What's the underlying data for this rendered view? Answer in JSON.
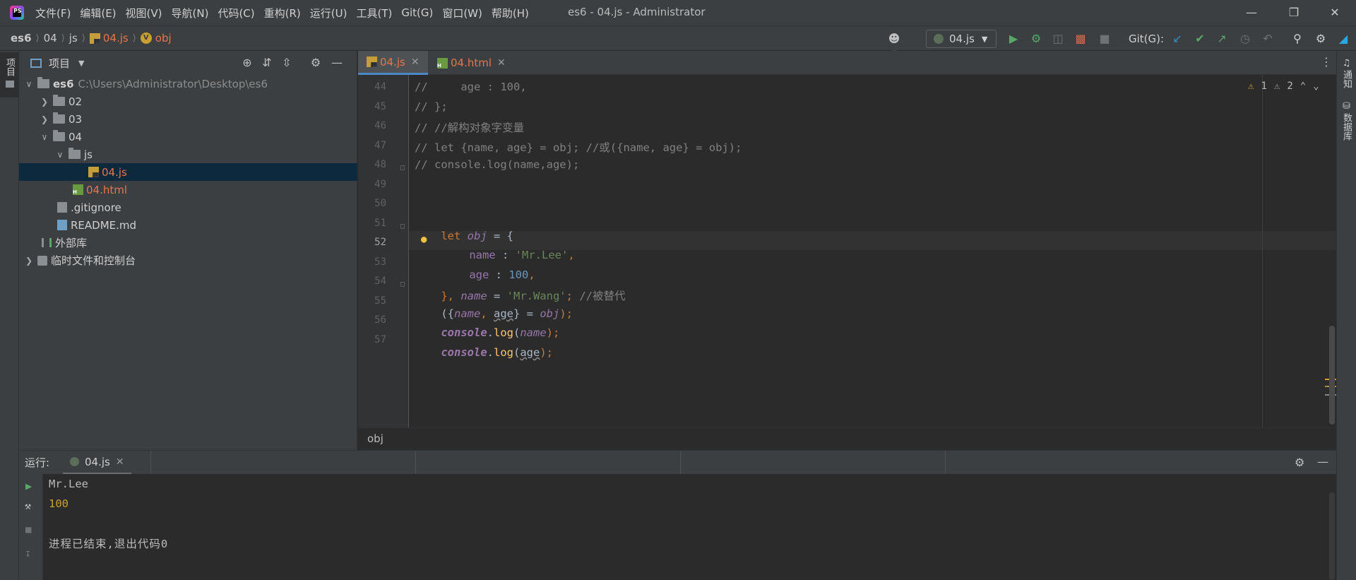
{
  "window": {
    "title": "es6 - 04.js - Administrator",
    "menu": [
      "文件(F)",
      "编辑(E)",
      "视图(V)",
      "导航(N)",
      "代码(C)",
      "重构(R)",
      "运行(U)",
      "工具(T)",
      "Git(G)",
      "窗口(W)",
      "帮助(H)"
    ]
  },
  "navbar": {
    "crumbs": [
      "es6",
      "04",
      "js",
      "04.js",
      "obj"
    ],
    "run_config": "04.js",
    "git_label": "Git(G):"
  },
  "stripes": {
    "left_project": "项目",
    "right_notifications": "通知",
    "right_database": "数据库"
  },
  "project": {
    "header": "项目",
    "tree": [
      {
        "label": "es6",
        "path": "C:\\Users\\Administrator\\Desktop\\es6"
      },
      {
        "label": "02"
      },
      {
        "label": "03"
      },
      {
        "label": "04"
      },
      {
        "label": "js"
      },
      {
        "label": "04.js"
      },
      {
        "label": "04.html"
      },
      {
        "label": ".gitignore"
      },
      {
        "label": "README.md"
      },
      {
        "label": "外部库"
      },
      {
        "label": "临时文件和控制台"
      }
    ]
  },
  "editor": {
    "tabs": [
      "04.js",
      "04.html"
    ],
    "inspection": {
      "warnings": "1",
      "weak_warnings": "2"
    },
    "line_numbers": [
      "44",
      "45",
      "46",
      "47",
      "48",
      "49",
      "50",
      "51",
      "52",
      "53",
      "54",
      "55",
      "56",
      "57"
    ],
    "lines": {
      "l44": "//     age : 100,",
      "l45": "// };",
      "l46": "// //解构对象字变量",
      "l47": "// let {name, age} = obj; //或({name, age} = obj);",
      "l48": "// console.log(name,age);",
      "l51_kw": "let",
      "l51_var": "obj",
      "l51_rest": " = {",
      "l52_prop": "name",
      "l52_sep": " : ",
      "l52_str": "'Mr.Lee'",
      "l52_end": ",",
      "l53_prop": "age",
      "l53_sep": " : ",
      "l53_num": "100",
      "l53_end": ",",
      "l54_a": "}, ",
      "l54_var": "name",
      "l54_eq": " = ",
      "l54_str": "'Mr.Wang'",
      "l54_semi": "; ",
      "l54_cm": "//被替代",
      "l55_a": "({",
      "l55_name": "name",
      "l55_comma": ", ",
      "l55_age": "age",
      "l55_b": "} = ",
      "l55_obj": "obj",
      "l55_end": ");",
      "l56_console": "console",
      "l56_dot": ".",
      "l56_log": "log",
      "l56_open": "(",
      "l56_arg": "name",
      "l56_close": ");",
      "l57_console": "console",
      "l57_dot": ".",
      "l57_log": "log",
      "l57_open": "(",
      "l57_arg": "age",
      "l57_close": ");"
    },
    "breadcrumb": "obj"
  },
  "run": {
    "label": "运行:",
    "tab": "04.js",
    "output": [
      "Mr.Lee",
      "100",
      "进程已结束,退出代码0"
    ]
  }
}
